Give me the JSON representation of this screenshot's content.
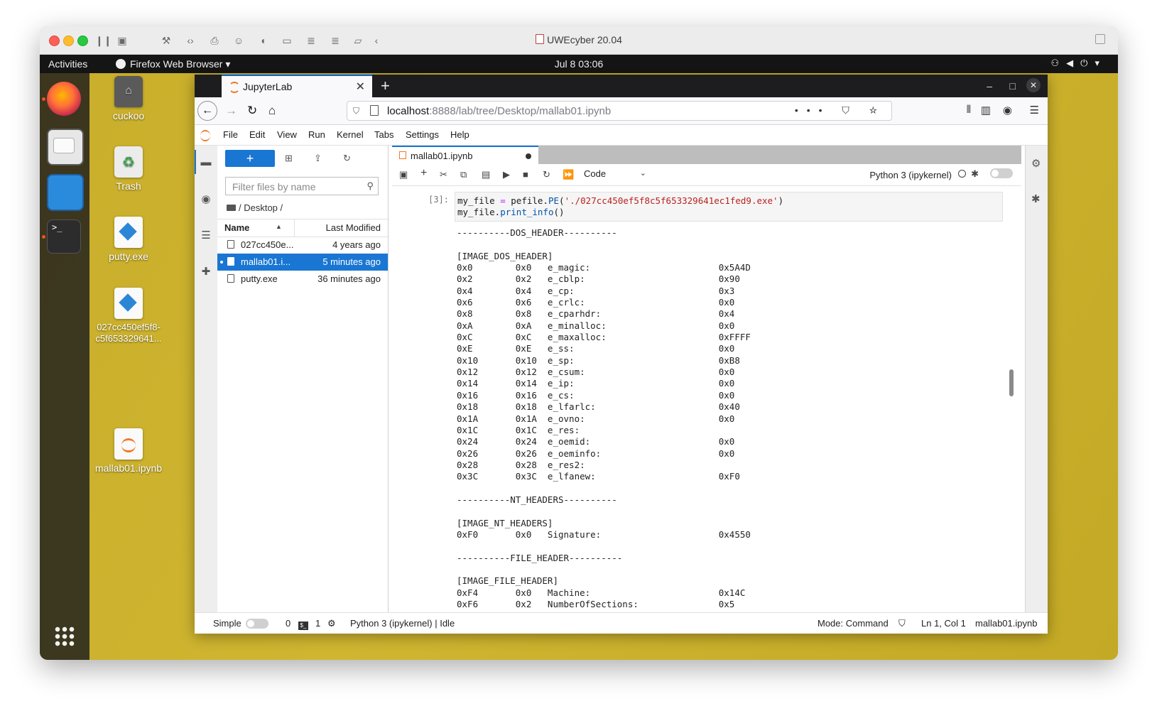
{
  "mac": {
    "title": "UWEcyber 20.04",
    "toolbar_icons": [
      "sidebar-icon",
      "snapshot-icon",
      "wrench-icon",
      "code-icon",
      "print-icon",
      "user-icon",
      "sound-icon",
      "camera-icon",
      "disk-icon",
      "disk2-icon",
      "folder-share-icon",
      "back-chevron-icon"
    ]
  },
  "ubuntu": {
    "activities": "Activities",
    "app_menu": "Firefox Web Browser ▾",
    "clock": "Jul 8  03:06",
    "tray_icons": [
      "network-icon",
      "volume-icon",
      "power-icon",
      "menu-arrow-icon"
    ]
  },
  "desktop_icons": [
    {
      "label": "cuckoo"
    },
    {
      "label": "Trash"
    },
    {
      "label": "putty.exe"
    },
    {
      "label": "027cc450ef5f8-c5f653329641..."
    },
    {
      "label": "mallab01.ipynb"
    }
  ],
  "dock": {
    "terminal_glyph": ">_"
  },
  "firefox": {
    "tab_title": "JupyterLab",
    "tab_close": "✕",
    "new_tab": "+",
    "url_host": "localhost",
    "url_rest": ":8888/lab/tree/Desktop/mallab01.ipynb",
    "page_actions": "••• ⛉ ☆",
    "min": "–",
    "max": "□",
    "close": "✕"
  },
  "jupyter": {
    "menu": [
      "File",
      "Edit",
      "View",
      "Run",
      "Kernel",
      "Tabs",
      "Settings",
      "Help"
    ],
    "filebrowser": {
      "new_label": "+",
      "filter_placeholder": "Filter files by name",
      "breadcrumb": "/ Desktop /",
      "col_name": "Name",
      "col_modified": "Last Modified",
      "rows": [
        {
          "name": "027cc450e...",
          "modified": "4 years ago"
        },
        {
          "name": "mallab01.i...",
          "modified": "5 minutes ago"
        },
        {
          "name": "putty.exe",
          "modified": "36 minutes ago"
        }
      ]
    },
    "notebook": {
      "tab_label": "mallab01.ipynb",
      "cell_type": "Code",
      "kernel": "Python 3 (ipykernel)",
      "prompt": "[3]:",
      "code_line1_a": "my_file ",
      "code_line1_op": "=",
      "code_line1_b": " pefile.",
      "code_line1_fn": "PE",
      "code_line1_c": "(",
      "code_line1_str": "'./027cc450ef5f8c5f653329641ec1fed9.exe'",
      "code_line1_d": ")",
      "code_line2_a": "my_file.",
      "code_line2_fn": "print_info",
      "code_line2_b": "()",
      "output": "----------DOS_HEADER----------\n\n[IMAGE_DOS_HEADER]\n0x0        0x0   e_magic:                        0x5A4D\n0x2        0x2   e_cblp:                         0x90\n0x4        0x4   e_cp:                           0x3\n0x6        0x6   e_crlc:                         0x0\n0x8        0x8   e_cparhdr:                      0x4\n0xA        0xA   e_minalloc:                     0x0\n0xC        0xC   e_maxalloc:                     0xFFFF\n0xE        0xE   e_ss:                           0x0\n0x10       0x10  e_sp:                           0xB8\n0x12       0x12  e_csum:                         0x0\n0x14       0x14  e_ip:                           0x0\n0x16       0x16  e_cs:                           0x0\n0x18       0x18  e_lfarlc:                       0x40\n0x1A       0x1A  e_ovno:                         0x0\n0x1C       0x1C  e_res:\n0x24       0x24  e_oemid:                        0x0\n0x26       0x26  e_oeminfo:                      0x0\n0x28       0x28  e_res2:\n0x3C       0x3C  e_lfanew:                       0xF0\n\n----------NT_HEADERS----------\n\n[IMAGE_NT_HEADERS]\n0xF0       0x0   Signature:                      0x4550\n\n----------FILE_HEADER----------\n\n[IMAGE_FILE_HEADER]\n0xF4       0x0   Machine:                        0x14C\n0xF6       0x2   NumberOfSections:               0x5"
    },
    "status": {
      "simple": "Simple",
      "terminals": "0",
      "kernels": "1",
      "kernel_state": "Python 3 (ipykernel) | Idle",
      "mode": "Mode: Command",
      "position": "Ln 1, Col 1",
      "file": "mallab01.ipynb"
    }
  }
}
